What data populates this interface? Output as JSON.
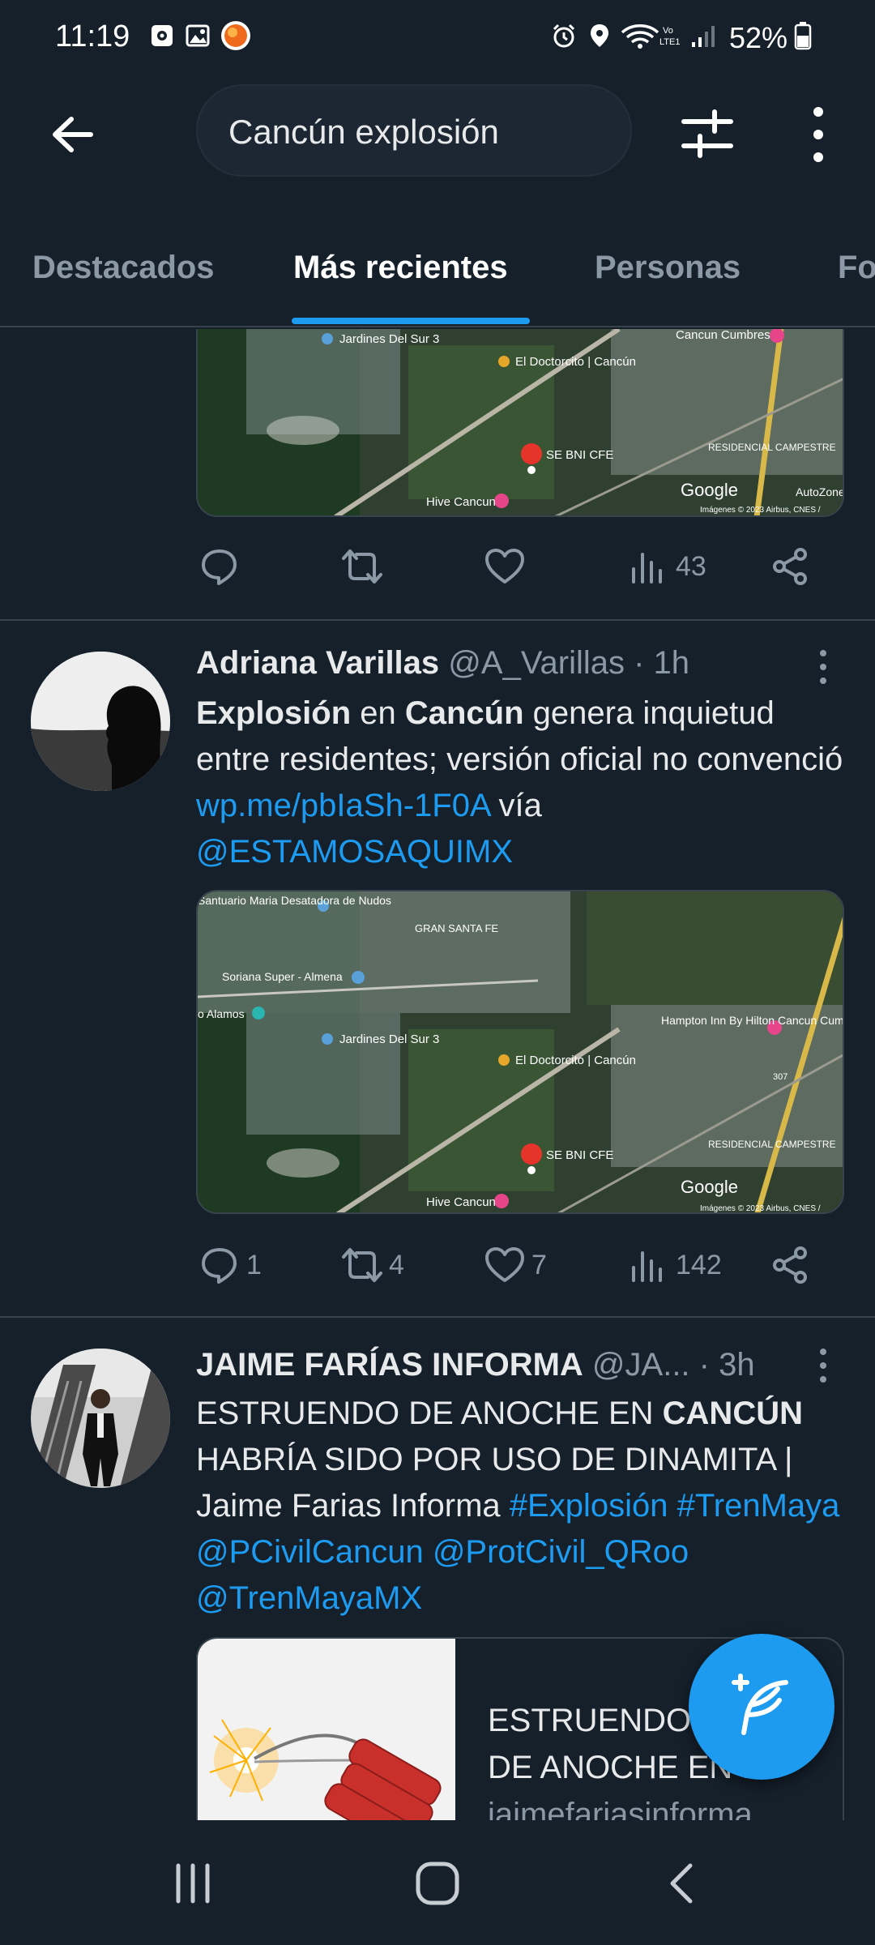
{
  "status_bar": {
    "time": "11:19",
    "battery": "52%"
  },
  "header": {
    "search_query": "Cancún explosión"
  },
  "tabs": [
    {
      "label": "Destacados"
    },
    {
      "label": "Más recientes"
    },
    {
      "label": "Personas"
    },
    {
      "label": "Fo"
    }
  ],
  "map_labels": {
    "jardines": "Jardines Del Sur 3",
    "doctorcito": "El Doctorcito | Cancún",
    "cumbres": "Cancun Cumbres",
    "residencial": "RESIDENCIAL CAMPESTRE",
    "sebni": "SE BNI CFE",
    "hive": "Hive Cancun",
    "autozone": "AutoZone Re",
    "google": "Google",
    "credit": "Imágenes © 2023 Airbus, CNES /",
    "santuario": "Santuario Maria Desatadora de Nudos",
    "gransantafe": "GRAN SANTA FE",
    "soriana": "Soriana Super - Almena",
    "alamos": "o Alamos",
    "hampton": "Hampton Inn By Hilton Cancun Cumbres",
    "road_307": "307"
  },
  "tweets": [
    {
      "actions": {
        "reply": "",
        "retweet": "",
        "like": "",
        "views": "43"
      }
    },
    {
      "name": "Adriana Varillas",
      "handle": "@A_Varillas",
      "time": "· 1h",
      "body": {
        "w1": "Explosión",
        "w2": " en ",
        "w3": "Cancún",
        "w4": " genera inquietud entre residentes; versión oficial no convenció ",
        "link": "wp.me/pbIaSh-1F0A",
        "w5": " vía ",
        "mention": "@ESTAMOSAQUIMX"
      },
      "actions": {
        "reply": "1",
        "retweet": "4",
        "like": "7",
        "views": "142"
      }
    },
    {
      "name": "JAIME FARÍAS INFORMA",
      "handle": "@JA...",
      "time": "· 3h",
      "body": {
        "w1": "ESTRUENDO DE ANOCHE EN ",
        "w2": "CANCÚN",
        "w3": " HABRÍA SIDO POR USO DE DINAMITA | Jaime Farias Informa ",
        "hashtag1": "#Explosión",
        "hashtag2": "#TrenMaya",
        "mention1": "@PCivilCancun",
        "mention2": "@ProtCivil_QRoo",
        "mention3": "@TrenMayaMX"
      },
      "card": {
        "title": "ESTRUENDO DE ANOCHE EN ...",
        "title_line1": "ESTRUENDO",
        "title_line2": "DE ANOCHE EN ...",
        "domain": "jaimefariasinforma..."
      }
    }
  ],
  "colors": {
    "background": "#15202b",
    "accent": "#1d9bf0",
    "text_secondary": "#8b98a5",
    "divider": "#38444d"
  }
}
